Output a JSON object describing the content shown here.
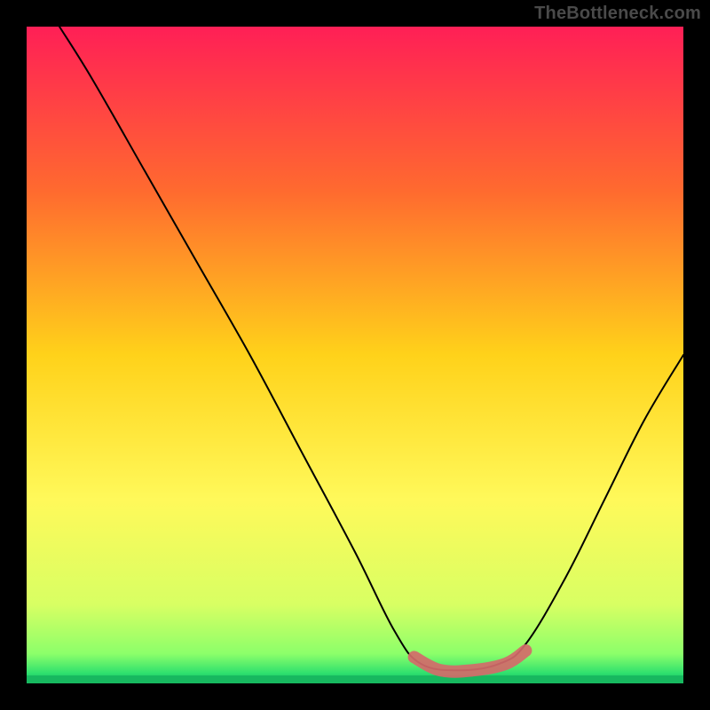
{
  "watermark": "TheBottleneck.com",
  "chart_data": {
    "type": "line",
    "title": "",
    "xlabel": "",
    "ylabel": "",
    "xlim": [
      0,
      100
    ],
    "ylim": [
      0,
      100
    ],
    "grid": false,
    "legend": false,
    "background_gradient": {
      "stops": [
        {
          "offset": 0.0,
          "color": "#ff1f56"
        },
        {
          "offset": 0.25,
          "color": "#ff6a2f"
        },
        {
          "offset": 0.5,
          "color": "#ffd21a"
        },
        {
          "offset": 0.72,
          "color": "#fff95a"
        },
        {
          "offset": 0.88,
          "color": "#d8ff63"
        },
        {
          "offset": 0.955,
          "color": "#8cff6a"
        },
        {
          "offset": 0.985,
          "color": "#2de06e"
        },
        {
          "offset": 1.0,
          "color": "#0fa85c"
        }
      ]
    },
    "series": [
      {
        "name": "bottleneck-curve",
        "stroke": "#000000",
        "stroke_width": 2,
        "points": [
          {
            "x": 5,
            "y": 100
          },
          {
            "x": 10,
            "y": 92
          },
          {
            "x": 18,
            "y": 78
          },
          {
            "x": 26,
            "y": 64
          },
          {
            "x": 34,
            "y": 50
          },
          {
            "x": 42,
            "y": 35
          },
          {
            "x": 50,
            "y": 20
          },
          {
            "x": 56,
            "y": 8
          },
          {
            "x": 60,
            "y": 3
          },
          {
            "x": 66,
            "y": 2
          },
          {
            "x": 72,
            "y": 3
          },
          {
            "x": 76,
            "y": 6
          },
          {
            "x": 82,
            "y": 16
          },
          {
            "x": 88,
            "y": 28
          },
          {
            "x": 94,
            "y": 40
          },
          {
            "x": 100,
            "y": 50
          }
        ]
      },
      {
        "name": "optimal-range-marker",
        "stroke": "#d46a6a",
        "stroke_width": 14,
        "linecap": "round",
        "points": [
          {
            "x": 59,
            "y": 4
          },
          {
            "x": 63,
            "y": 2
          },
          {
            "x": 68,
            "y": 2
          },
          {
            "x": 73,
            "y": 3
          },
          {
            "x": 76,
            "y": 5
          }
        ]
      }
    ],
    "annotations": []
  }
}
